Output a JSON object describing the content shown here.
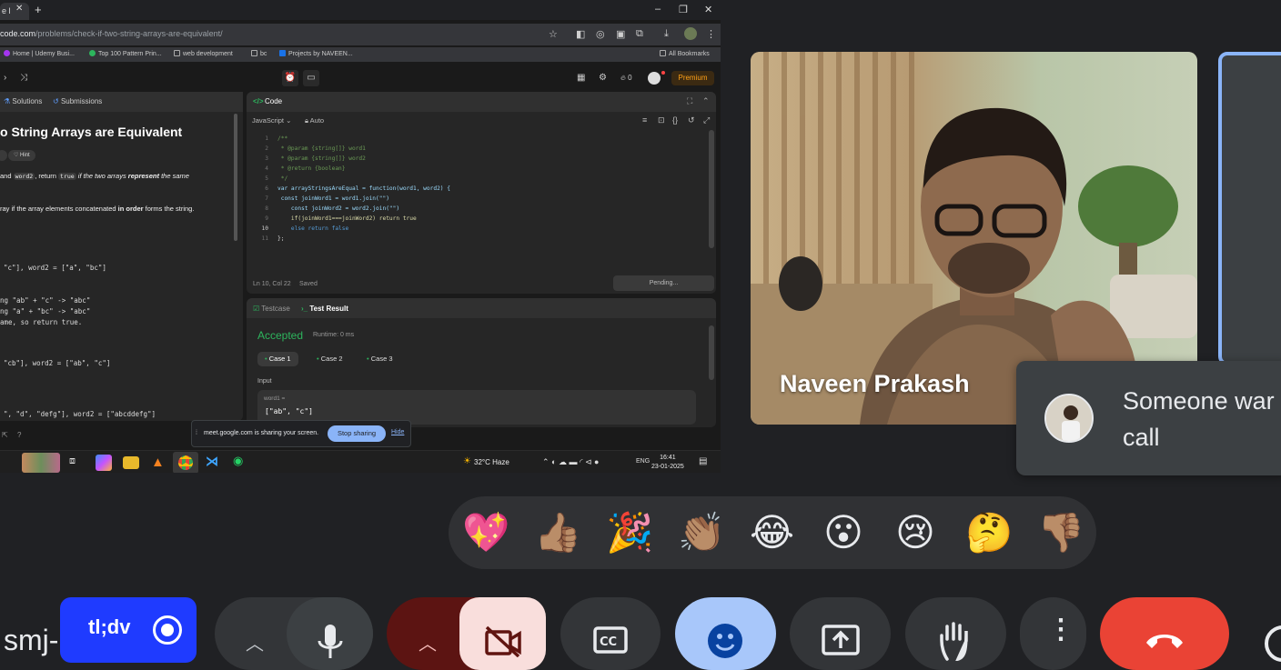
{
  "browser": {
    "tab_title": "e l",
    "url_host": "code.com",
    "url_path": "/problems/check-if-two-string-arrays-are-equivalent/",
    "bookmarks": [
      "Home | Udemy Busi...",
      "Top 100 Pattern Prin...",
      "web development",
      "bc",
      "Projects by NAVEEN..."
    ],
    "all_bookmarks": "All Bookmarks",
    "streak": "0",
    "premium": "Premium"
  },
  "problem": {
    "tabs": [
      "Solutions",
      "Submissions"
    ],
    "title": "o String Arrays are Equivalent",
    "hint": "Hint",
    "statement_1a": "and ",
    "statement_code1": "word2",
    "statement_1b": ", return ",
    "statement_code2": "true",
    "statement_1c": " if the two arrays ",
    "statement_1d": "represent",
    "statement_1e": " the same",
    "statement_2a": "ray if the array elements concatenated ",
    "statement_2b": "in order",
    "statement_2c": " forms the string.",
    "ex1": "\"c\"], word2 = [\"a\", \"bc\"]",
    "ex1_e1": "ng \"ab\" + \"c\" -> \"abc\"",
    "ex1_e2": "ng \"a\" + \"bc\" -> \"abc\"",
    "ex1_e3": "ame, so return true.",
    "ex2": "\"cb\"], word2 = [\"ab\", \"c\"]",
    "ex3": "\", \"d\", \"defg\"], word2 = [\"abcddefg\"]"
  },
  "code": {
    "title": "Code",
    "language": "JavaScript",
    "mode": "Auto",
    "lines": [
      "/**",
      " * @param {string[]} word1",
      " * @param {string[]} word2",
      " * @return {boolean}",
      " */",
      "var arrayStringsAreEqual = function(word1, word2) {",
      " const joinWord1 = word1.join(\"\")",
      "    const joinWord2 = word2.join(\"\")",
      "    if(joinWord1===joinWord2) return true",
      "    else return false",
      "};"
    ],
    "status": "Ln 10, Col 22",
    "saved": "Saved",
    "pending": "Pending..."
  },
  "result": {
    "tabs": [
      "Testcase",
      "Test Result"
    ],
    "status": "Accepted",
    "runtime": "Runtime: 0 ms",
    "cases": [
      "Case 1",
      "Case 2",
      "Case 3"
    ],
    "input_label": "Input",
    "var_label": "word1 =",
    "var_value": "[\"ab\", \"c\"]"
  },
  "share_banner": {
    "text": "meet.google.com is sharing your screen.",
    "stop": "Stop sharing",
    "hide": "Hide"
  },
  "taskbar": {
    "weather": "32°C  Haze",
    "lang": "ENG",
    "time": "16:41",
    "date": "23-01-2025"
  },
  "meet": {
    "participant": "Naveen Prakash",
    "toast_line1": "Someone war",
    "toast_line2": "call",
    "reactions": [
      "💖",
      "👍🏽",
      "🎉",
      "👏🏽",
      "😂",
      "😮",
      "😢",
      "🤔",
      "👎🏽"
    ],
    "meeting_code": "smj-",
    "tldv": "tl;dv",
    "colors": {
      "end_call": "#ea4335",
      "active_blue": "#a8c7fa",
      "cam_off": "#f9dedc",
      "mic_dark": "#5c1412"
    }
  }
}
